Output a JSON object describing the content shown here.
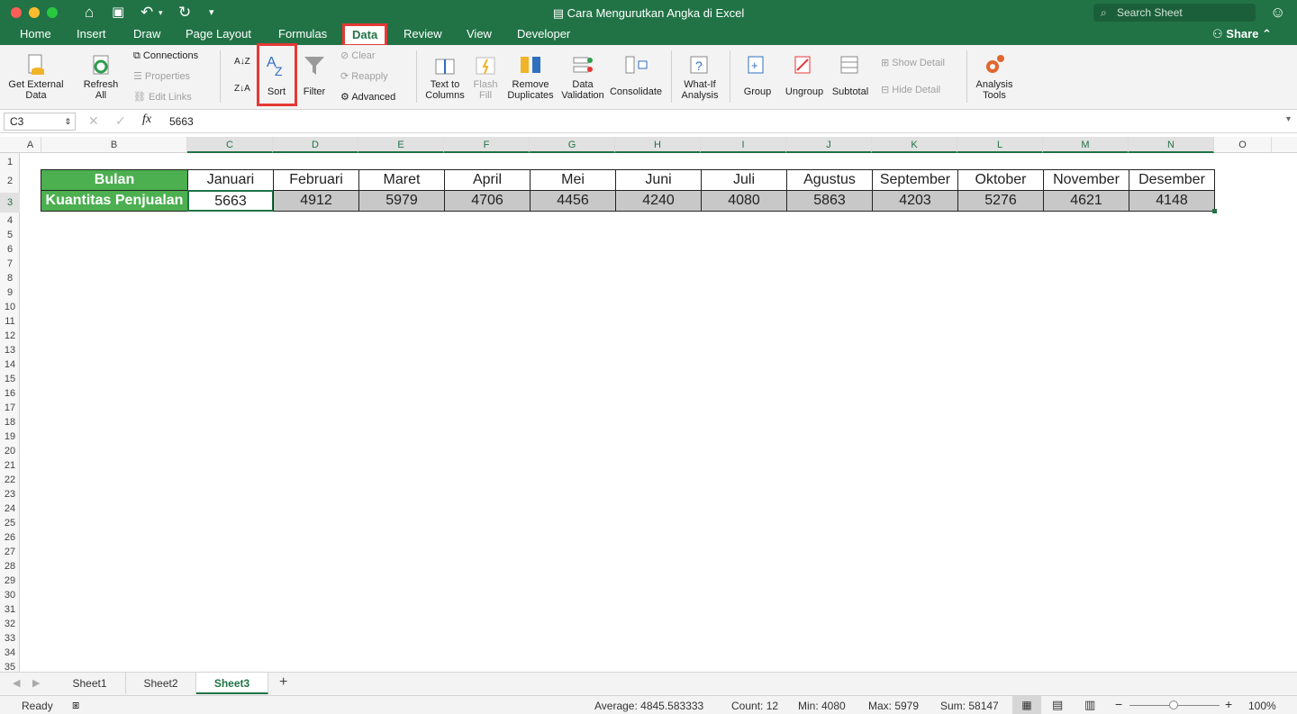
{
  "window": {
    "title": "Cara Mengurutkan Angka di Excel",
    "search_placeholder": "Search Sheet"
  },
  "menu": {
    "tabs": [
      "Home",
      "Insert",
      "Draw",
      "Page Layout",
      "Formulas",
      "Data",
      "Review",
      "View",
      "Developer"
    ],
    "active": "Data",
    "share_label": "Share"
  },
  "ribbon": {
    "get_external_data": [
      "Get External",
      "Data"
    ],
    "refresh_all": [
      "Refresh",
      "All"
    ],
    "connections": "Connections",
    "properties": "Properties",
    "edit_links": "Edit Links",
    "sort": "Sort",
    "filter": "Filter",
    "clear": "Clear",
    "reapply": "Reapply",
    "advanced": "Advanced",
    "text_to_columns": [
      "Text to",
      "Columns"
    ],
    "flash_fill": [
      "Flash",
      "Fill"
    ],
    "remove_duplicates": [
      "Remove",
      "Duplicates"
    ],
    "data_validation": [
      "Data",
      "Validation"
    ],
    "consolidate": "Consolidate",
    "what_if": [
      "What-If",
      "Analysis"
    ],
    "group": "Group",
    "ungroup": "Ungroup",
    "subtotal": "Subtotal",
    "show_detail": "Show Detail",
    "hide_detail": "Hide Detail",
    "analysis_tools": [
      "Analysis",
      "Tools"
    ]
  },
  "formula_bar": {
    "cell_ref": "C3",
    "value": "5663"
  },
  "sheet": {
    "columns": [
      "A",
      "B",
      "C",
      "D",
      "E",
      "F",
      "G",
      "H",
      "I",
      "J",
      "K",
      "L",
      "M",
      "N",
      "O"
    ],
    "rows": [
      "1",
      "2",
      "3",
      "4",
      "5",
      "6",
      "7",
      "8",
      "9",
      "10",
      "11",
      "12",
      "13",
      "14",
      "15",
      "16",
      "17",
      "18",
      "19",
      "20",
      "21",
      "22",
      "23",
      "24",
      "25",
      "26",
      "27",
      "28",
      "29",
      "30",
      "31",
      "32",
      "33",
      "34",
      "35"
    ],
    "row2_label": "Bulan",
    "row3_label": "Kuantitas Penjualan",
    "months": [
      "Januari",
      "Februari",
      "Maret",
      "April",
      "Mei",
      "Juni",
      "Juli",
      "Agustus",
      "September",
      "Oktober",
      "November",
      "Desember"
    ],
    "quantities": [
      "5663",
      "4912",
      "5979",
      "4706",
      "4456",
      "4240",
      "4080",
      "5863",
      "4203",
      "5276",
      "4621",
      "4148"
    ]
  },
  "tabs": {
    "sheets": [
      "Sheet1",
      "Sheet2",
      "Sheet3"
    ],
    "active": "Sheet3"
  },
  "status": {
    "ready": "Ready",
    "average": "Average: 4845.583333",
    "count": "Count: 12",
    "min": "Min: 4080",
    "max": "Max: 5979",
    "sum": "Sum: 58147",
    "zoom": "100%"
  },
  "colors": {
    "excel_green": "#217346",
    "header_fill": "#4caf50",
    "quantity_fill": "#c8c8c8",
    "highlight": "#e53935"
  }
}
